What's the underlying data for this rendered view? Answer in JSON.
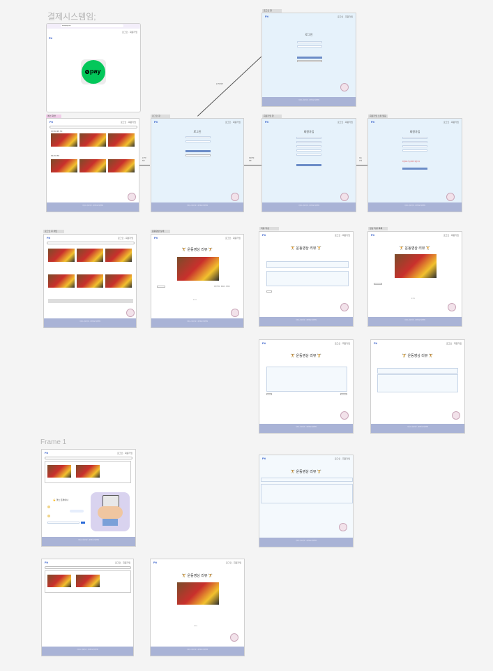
{
  "canvas": {
    "section_title": "결제시스템임;",
    "frame1_label": "Frame 1"
  },
  "common": {
    "logo": "Fit",
    "nav": "로그인 · 회원가입",
    "search_placeholder": "운동 검색",
    "footer_text": "서비스 이용약관 · 개인정보처리방침",
    "footer_lines": "회사명 · 대표자\n주소 · 고객센터"
  },
  "browser": {
    "url": "naverpay.com",
    "pay_text": "pay",
    "pay_mark": "N",
    "pay_color": "#03c75a"
  },
  "tags": {
    "main": "메인 화면",
    "login": "로그인 창",
    "login_top": "로그인 창",
    "signup": "회원가입 창",
    "signup_error": "회원가입 오류 알림",
    "main_logged": "로그인 후 메인",
    "video": "운동영상 상세",
    "review_write": "리뷰 작성",
    "video_review": "영상 리뷰 목록"
  },
  "arrows": {
    "login_label": "로그인\n버튼",
    "signup_label": "회원가입\n버튼",
    "next_label": "다음\n단계",
    "diag_label": "로그인 성공"
  },
  "login": {
    "title": "로그인",
    "id_label": "ID",
    "pw_label": "PW",
    "btn": "로그인",
    "btn2": "회원가입"
  },
  "signup": {
    "title": "회원가입",
    "error": "비밀번호가 일치하지 않습니다"
  },
  "main": {
    "sec1": "최신 운동 영상 추천",
    "sec2": "운동 부위 추천",
    "caption": "[운동] 전신 루틴 따라하기 쉬운 홈트 영상"
  },
  "video": {
    "title": "🏋️ 운동영상 리뷰 🏋️",
    "thumb_badge": "BLOW",
    "review_btn": "리뷰쓰기",
    "review_meta": "리뷰 작성 · 조회순 · 최신순",
    "cols": [
      "번호",
      "제목",
      "작성자",
      "조회",
      "날짜"
    ],
    "pages": "1 2 3"
  },
  "review": {
    "input_title": "제목을 입력하세요",
    "body": "본문 내용을 입력해 주세요. 운동 영상 리뷰를 작성하고 다른 회원들과 공유하세요.",
    "submit": "등록",
    "cancel": "취소"
  },
  "chat": {
    "header": "채팅",
    "title": "💪 헬스 트레이너",
    "msg_bot": "안녕하세요! 운동 루틴을 추천해 드릴게요.",
    "msg_user": "오늘 운동 추천해줘",
    "send": "전송",
    "input_placeholder": "메시지를 입력하세요"
  }
}
